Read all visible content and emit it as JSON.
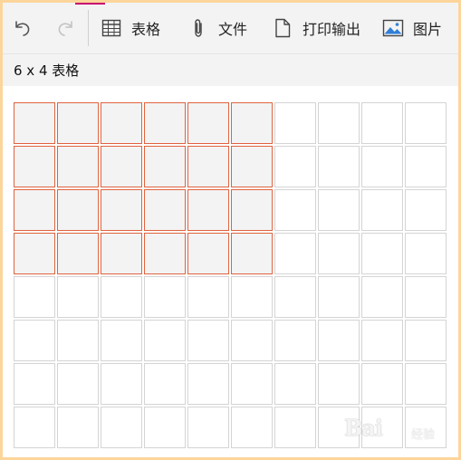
{
  "toolbar": {
    "table_label": "表格",
    "file_label": "文件",
    "print_label": "打印输出",
    "image_label": "图片"
  },
  "status": {
    "selection_text": "6 x 4 表格"
  },
  "grid": {
    "columns": 10,
    "rows": 8,
    "selected_columns": 6,
    "selected_rows": 4
  },
  "watermark": {
    "text": "Bai",
    "sub": "经验"
  },
  "colors": {
    "selected_border": "#e0633f",
    "selected_fill": "#f3f3f3",
    "cell_border": "#d4d4d4",
    "frame_border": "#fcd59a",
    "toolbar_bg": "#f3f3f3"
  }
}
